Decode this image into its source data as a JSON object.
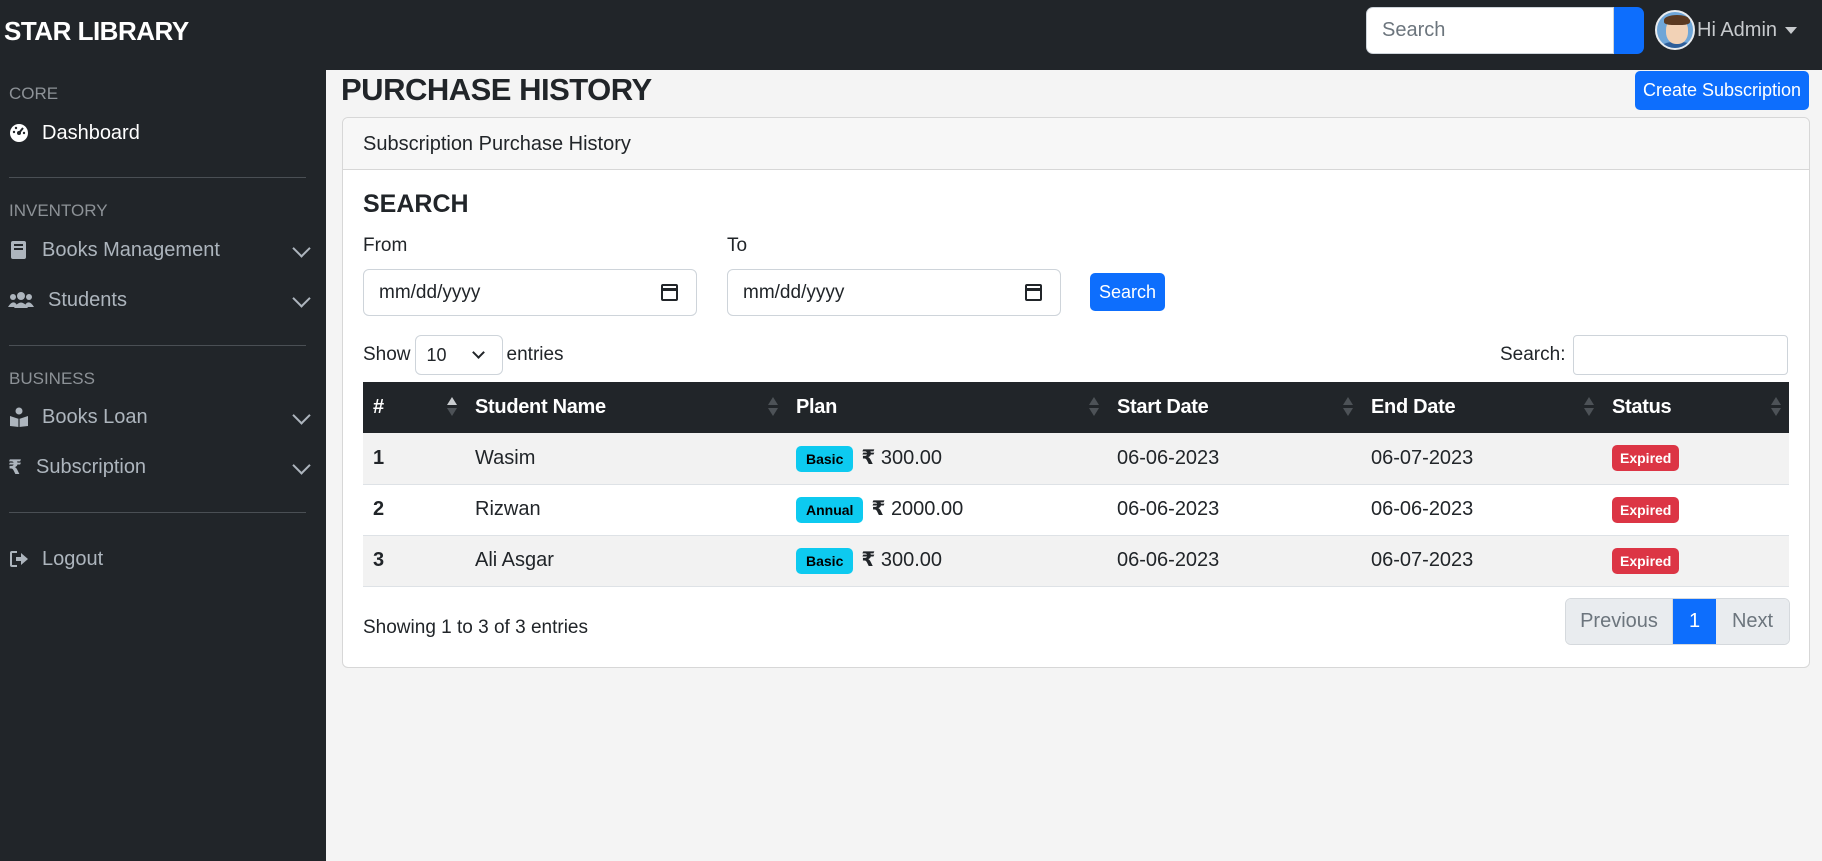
{
  "navbar": {
    "brand": "STAR LIBRARY",
    "search_placeholder": "Search",
    "user_greeting": "Hi Admin"
  },
  "sidebar": {
    "sections": [
      {
        "heading": "CORE",
        "items": [
          {
            "label": "Dashboard",
            "icon": "dashboard-gauge-icon",
            "active": true
          }
        ]
      },
      {
        "heading": "INVENTORY",
        "items": [
          {
            "label": "Books Management",
            "icon": "book-icon"
          },
          {
            "label": "Students",
            "icon": "users-icon"
          }
        ]
      },
      {
        "heading": "BUSINESS",
        "items": [
          {
            "label": "Books Loan",
            "icon": "book-reader-icon"
          },
          {
            "label": "Subscription",
            "icon": "rupee-icon"
          }
        ]
      }
    ],
    "logout_label": "Logout"
  },
  "page": {
    "title": "PURCHASE HISTORY",
    "create_button": "Create Subscription"
  },
  "card": {
    "header": "Subscription Purchase History",
    "search_title": "SEARCH",
    "from_label": "From",
    "to_label": "To",
    "from_value": "mm/dd/yyyy",
    "to_value": "mm/dd/yyyy",
    "search_button": "Search"
  },
  "datatable": {
    "show_label": "Show",
    "entries_label": "entries",
    "page_length": "10",
    "filter_label": "Search:",
    "columns": [
      "#",
      "Student Name",
      "Plan",
      "Start Date",
      "End Date",
      "Status"
    ],
    "rows": [
      {
        "num": "1",
        "name": "Wasim",
        "plan": "Basic",
        "currency": "₹",
        "amount": "300.00",
        "start": "06-06-2023",
        "end": "06-07-2023",
        "status": "Expired"
      },
      {
        "num": "2",
        "name": "Rizwan",
        "plan": "Annual",
        "currency": "₹",
        "amount": "2000.00",
        "start": "06-06-2023",
        "end": "06-06-2023",
        "status": "Expired"
      },
      {
        "num": "3",
        "name": "Ali Asgar",
        "plan": "Basic",
        "currency": "₹",
        "amount": "300.00",
        "start": "06-06-2023",
        "end": "06-07-2023",
        "status": "Expired"
      }
    ],
    "info": "Showing 1 to 3 of 3 entries",
    "pagination": {
      "previous": "Previous",
      "current": "1",
      "next": "Next"
    }
  },
  "colors": {
    "dark": "#212529",
    "primary": "#0d6efd",
    "info_badge": "#0dcaf0",
    "danger": "#dc3545"
  }
}
